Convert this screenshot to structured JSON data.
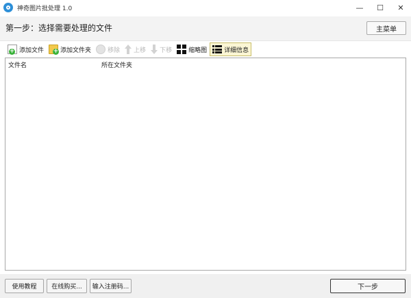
{
  "window": {
    "title": "神奇图片批处理 1.0",
    "icon": "app-icon",
    "controls": {
      "minimize": "—",
      "maximize": "☐",
      "close": "✕"
    }
  },
  "step": {
    "title": "第一步：选择需要处理的文件",
    "main_menu_label": "主菜单"
  },
  "toolbar": {
    "add_file": "添加文件",
    "add_folder": "添加文件夹",
    "remove": "移除",
    "move_up": "上移",
    "move_down": "下移",
    "thumbnail": "缩略图",
    "detail": "详细信息"
  },
  "file_list": {
    "columns": [
      "文件名",
      "所在文件夹"
    ]
  },
  "footer": {
    "tutorial": "使用教程",
    "buy": "在线购买...",
    "register": "输入注册码...",
    "next": "下一步"
  },
  "colors": {
    "app_icon": "#2d8fd8",
    "add_green": "#3bb33b",
    "folder_yellow": "#f2c94c",
    "active_tab_bg": "#fbf6d4"
  }
}
